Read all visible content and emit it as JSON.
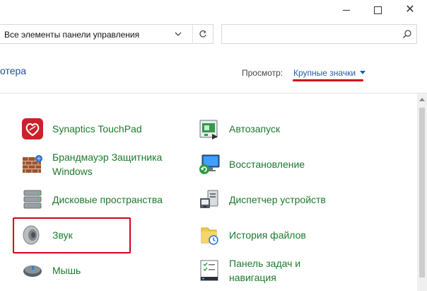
{
  "window": {
    "minimize": "Свернуть",
    "maximize": "Развернуть",
    "close": "Закрыть"
  },
  "address": {
    "path": "Все элементы панели управления",
    "search_placeholder": ""
  },
  "header": {
    "title": "отера",
    "view_label": "Просмотр:",
    "view_value": "Крупные значки"
  },
  "items_left": [
    {
      "label": "Synaptics TouchPad",
      "icon": "synaptics-icon"
    },
    {
      "label": "Брандмауэр Защитника Windows",
      "icon": "firewall-icon"
    },
    {
      "label": "Дисковые пространства",
      "icon": "storage-spaces-icon"
    },
    {
      "label": "Звук",
      "icon": "speaker-icon"
    },
    {
      "label": "Мышь",
      "icon": "mouse-icon"
    }
  ],
  "items_right": [
    {
      "label": "Автозапуск",
      "icon": "autoplay-icon"
    },
    {
      "label": "Восстановление",
      "icon": "recovery-icon"
    },
    {
      "label": "Диспетчер устройств",
      "icon": "device-manager-icon"
    },
    {
      "label": "История файлов",
      "icon": "file-history-icon"
    },
    {
      "label": "Панель задач и навигация",
      "icon": "taskbar-icon"
    }
  ],
  "colors": {
    "link_green": "#1b7a2c",
    "accent_blue": "#1a5fb4",
    "highlight_red": "#d0021b"
  }
}
